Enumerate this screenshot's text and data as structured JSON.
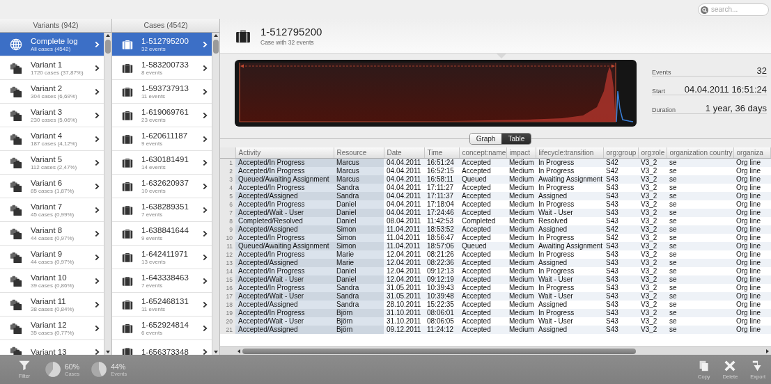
{
  "search": {
    "placeholder": "search..."
  },
  "variants": {
    "title": "Variants (942)",
    "items": [
      {
        "kind": "log",
        "title": "Complete log",
        "subtitle": "All cases (4542)",
        "selected": true
      },
      {
        "kind": "variant",
        "title": "Variant 1",
        "subtitle": "1720 cases (37,87%)",
        "selected": false
      },
      {
        "kind": "variant",
        "title": "Variant 2",
        "subtitle": "304 cases (6,69%)",
        "selected": false
      },
      {
        "kind": "variant",
        "title": "Variant 3",
        "subtitle": "230 cases (5,06%)",
        "selected": false
      },
      {
        "kind": "variant",
        "title": "Variant 4",
        "subtitle": "187 cases (4,12%)",
        "selected": false
      },
      {
        "kind": "variant",
        "title": "Variant 5",
        "subtitle": "112 cases (2,47%)",
        "selected": false
      },
      {
        "kind": "variant",
        "title": "Variant 6",
        "subtitle": "85 cases (1,87%)",
        "selected": false
      },
      {
        "kind": "variant",
        "title": "Variant 7",
        "subtitle": "45 cases (0,99%)",
        "selected": false
      },
      {
        "kind": "variant",
        "title": "Variant 8",
        "subtitle": "44 cases (0,97%)",
        "selected": false
      },
      {
        "kind": "variant",
        "title": "Variant 9",
        "subtitle": "44 cases (0,97%)",
        "selected": false
      },
      {
        "kind": "variant",
        "title": "Variant 10",
        "subtitle": "39 cases (0,86%)",
        "selected": false
      },
      {
        "kind": "variant",
        "title": "Variant 11",
        "subtitle": "38 cases (0,84%)",
        "selected": false
      },
      {
        "kind": "variant",
        "title": "Variant 12",
        "subtitle": "35 cases (0,77%)",
        "selected": false
      },
      {
        "kind": "variant",
        "title": "Variant 13",
        "selected": false
      }
    ]
  },
  "cases": {
    "title": "Cases (4542)",
    "items": [
      {
        "title": "1-512795200",
        "subtitle": "32 events",
        "selected": true
      },
      {
        "title": "1-583200733",
        "subtitle": "8 events",
        "selected": false
      },
      {
        "title": "1-593737913",
        "subtitle": "11 events",
        "selected": false
      },
      {
        "title": "1-619069761",
        "subtitle": "23 events",
        "selected": false
      },
      {
        "title": "1-620611187",
        "subtitle": "9 events",
        "selected": false
      },
      {
        "title": "1-630181491",
        "subtitle": "14 events",
        "selected": false
      },
      {
        "title": "1-632620937",
        "subtitle": "10 events",
        "selected": false
      },
      {
        "title": "1-638289351",
        "subtitle": "7 events",
        "selected": false
      },
      {
        "title": "1-638841644",
        "subtitle": "9 events",
        "selected": false
      },
      {
        "title": "1-642411971",
        "subtitle": "13 events",
        "selected": false
      },
      {
        "title": "1-643338463",
        "subtitle": "7 events",
        "selected": false
      },
      {
        "title": "1-652468131",
        "subtitle": "11 events",
        "selected": false
      },
      {
        "title": "1-652924814",
        "subtitle": "6 events",
        "selected": false
      },
      {
        "title": "1-656373348",
        "selected": false
      }
    ]
  },
  "case_header": {
    "title": "1-512795200",
    "subtitle": "Case with 32 events"
  },
  "stats": [
    {
      "label": "Events",
      "value": "32"
    },
    {
      "label": "Start",
      "value": "04.04.2011 16:51:24"
    },
    {
      "label": "Duration",
      "value": "1 year, 36 days"
    }
  ],
  "view_toggle": [
    {
      "label": "Graph",
      "selected": false
    },
    {
      "label": "Table",
      "selected": true
    }
  ],
  "table": {
    "columns": [
      "Activity",
      "Resource",
      "Date",
      "Time",
      "concept:name",
      "impact",
      "lifecycle:transition",
      "org:group",
      "org:role",
      "organization country",
      "organiza"
    ],
    "rows": [
      {
        "number": "1",
        "cells": [
          "Accepted/In Progress",
          "Marcus",
          "04.04.2011",
          "16:51:24",
          "Accepted",
          "Medium",
          "In Progress",
          "S42",
          "V3_2",
          "se",
          "Org line"
        ]
      },
      {
        "number": "2",
        "cells": [
          "Accepted/In Progress",
          "Marcus",
          "04.04.2011",
          "16:52:15",
          "Accepted",
          "Medium",
          "In Progress",
          "S42",
          "V3_2",
          "se",
          "Org line"
        ]
      },
      {
        "number": "3",
        "cells": [
          "Queued/Awaiting Assignment",
          "Marcus",
          "04.04.2011",
          "16:58:11",
          "Queued",
          "Medium",
          "Awaiting Assignment",
          "S43",
          "V3_2",
          "se",
          "Org line"
        ]
      },
      {
        "number": "4",
        "cells": [
          "Accepted/In Progress",
          "Sandra",
          "04.04.2011",
          "17:11:27",
          "Accepted",
          "Medium",
          "In Progress",
          "S43",
          "V3_2",
          "se",
          "Org line"
        ]
      },
      {
        "number": "5",
        "cells": [
          "Accepted/Assigned",
          "Sandra",
          "04.04.2011",
          "17:11:37",
          "Accepted",
          "Medium",
          "Assigned",
          "S43",
          "V3_2",
          "se",
          "Org line"
        ]
      },
      {
        "number": "6",
        "cells": [
          "Accepted/In Progress",
          "Daniel",
          "04.04.2011",
          "17:18:04",
          "Accepted",
          "Medium",
          "In Progress",
          "S43",
          "V3_2",
          "se",
          "Org line"
        ]
      },
      {
        "number": "7",
        "cells": [
          "Accepted/Wait - User",
          "Daniel",
          "04.04.2011",
          "17:24:46",
          "Accepted",
          "Medium",
          "Wait - User",
          "S43",
          "V3_2",
          "se",
          "Org line"
        ]
      },
      {
        "number": "8",
        "cells": [
          "Completed/Resolved",
          "Daniel",
          "08.04.2011",
          "11:42:53",
          "Completed",
          "Medium",
          "Resolved",
          "S43",
          "V3_2",
          "se",
          "Org line"
        ]
      },
      {
        "number": "9",
        "cells": [
          "Accepted/Assigned",
          "Simon",
          "11.04.2011",
          "18:53:52",
          "Accepted",
          "Medium",
          "Assigned",
          "S42",
          "V3_2",
          "se",
          "Org line"
        ]
      },
      {
        "number": "10",
        "cells": [
          "Accepted/In Progress",
          "Simon",
          "11.04.2011",
          "18:56:47",
          "Accepted",
          "Medium",
          "In Progress",
          "S42",
          "V3_2",
          "se",
          "Org line"
        ]
      },
      {
        "number": "11",
        "cells": [
          "Queued/Awaiting Assignment",
          "Simon",
          "11.04.2011",
          "18:57:06",
          "Queued",
          "Medium",
          "Awaiting Assignment",
          "S43",
          "V3_2",
          "se",
          "Org line"
        ]
      },
      {
        "number": "12",
        "cells": [
          "Accepted/In Progress",
          "Marie",
          "12.04.2011",
          "08:21:26",
          "Accepted",
          "Medium",
          "In Progress",
          "S43",
          "V3_2",
          "se",
          "Org line"
        ]
      },
      {
        "number": "13",
        "cells": [
          "Accepted/Assigned",
          "Marie",
          "12.04.2011",
          "08:22:36",
          "Accepted",
          "Medium",
          "Assigned",
          "S43",
          "V3_2",
          "se",
          "Org line"
        ]
      },
      {
        "number": "14",
        "cells": [
          "Accepted/In Progress",
          "Daniel",
          "12.04.2011",
          "09:12:13",
          "Accepted",
          "Medium",
          "In Progress",
          "S43",
          "V3_2",
          "se",
          "Org line"
        ]
      },
      {
        "number": "15",
        "cells": [
          "Accepted/Wait - User",
          "Daniel",
          "12.04.2011",
          "09:12:19",
          "Accepted",
          "Medium",
          "Wait - User",
          "S43",
          "V3_2",
          "se",
          "Org line"
        ]
      },
      {
        "number": "16",
        "cells": [
          "Accepted/In Progress",
          "Sandra",
          "31.05.2011",
          "10:39:43",
          "Accepted",
          "Medium",
          "In Progress",
          "S43",
          "V3_2",
          "se",
          "Org line"
        ]
      },
      {
        "number": "17",
        "cells": [
          "Accepted/Wait - User",
          "Sandra",
          "31.05.2011",
          "10:39:48",
          "Accepted",
          "Medium",
          "Wait - User",
          "S43",
          "V3_2",
          "se",
          "Org line"
        ]
      },
      {
        "number": "18",
        "cells": [
          "Accepted/Assigned",
          "Sandra",
          "28.10.2011",
          "15:22:35",
          "Accepted",
          "Medium",
          "Assigned",
          "S43",
          "V3_2",
          "se",
          "Org line"
        ]
      },
      {
        "number": "19",
        "cells": [
          "Accepted/In Progress",
          "Björn",
          "31.10.2011",
          "08:06:01",
          "Accepted",
          "Medium",
          "In Progress",
          "S43",
          "V3_2",
          "se",
          "Org line"
        ]
      },
      {
        "number": "20",
        "cells": [
          "Accepted/Wait - User",
          "Björn",
          "31.10.2011",
          "08:06:05",
          "Accepted",
          "Medium",
          "Wait - User",
          "S43",
          "V3_2",
          "se",
          "Org line"
        ]
      },
      {
        "number": "21",
        "cells": [
          "Accepted/Assigned",
          "Björn",
          "09.12.2011",
          "11:24:12",
          "Accepted",
          "Medium",
          "Assigned",
          "S43",
          "V3_2",
          "se",
          "Org line"
        ]
      }
    ]
  },
  "toolbar": {
    "filter": "Filter",
    "meters": [
      {
        "value": "60%",
        "label": "Cases"
      },
      {
        "value": "44%",
        "label": "Events"
      }
    ],
    "actions": [
      {
        "kind": "copy",
        "label": "Copy"
      },
      {
        "kind": "delete",
        "label": "Delete"
      },
      {
        "kind": "export",
        "label": "Export"
      }
    ]
  }
}
